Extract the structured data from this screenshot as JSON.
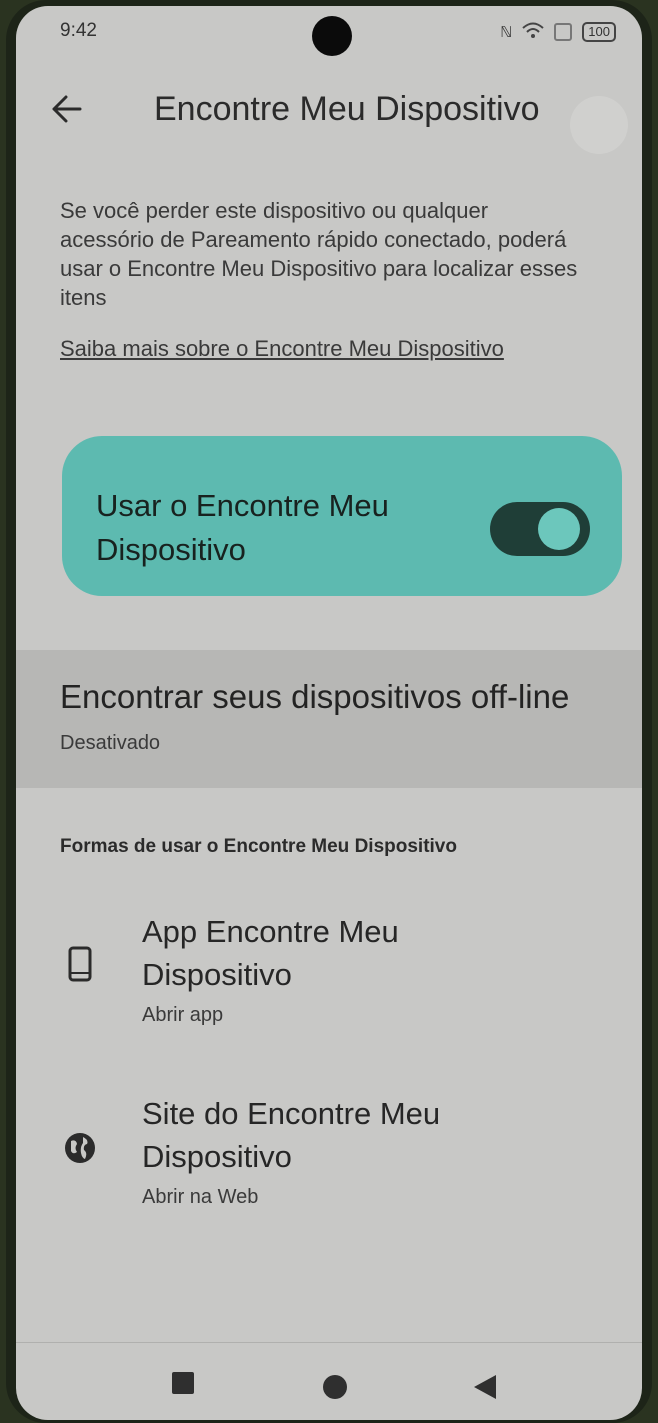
{
  "status_bar": {
    "time": "9:42",
    "battery": "100"
  },
  "app_bar": {
    "title": "Encontre Meu Dispositivo"
  },
  "description": "Se você perder este dispositivo ou qualquer acessório de Pareamento rápido conectado, poderá usar o Encontre Meu Dispositivo para localizar esses itens",
  "learn_more_link": "Saiba mais sobre o Encontre Meu Dispositivo",
  "main_toggle": {
    "label": "Usar o Encontre Meu Dispositivo",
    "state": "on"
  },
  "offline": {
    "title": "Encontrar seus dispositivos off-line",
    "subtitle": "Desativado"
  },
  "ways_section": {
    "header": "Formas de usar o Encontre Meu Dispositivo",
    "items": [
      {
        "title": "App Encontre Meu Dispositivo",
        "subtitle": "Abrir app",
        "icon": "phone-icon"
      },
      {
        "title": "Site do Encontre Meu Dispositivo",
        "subtitle": "Abrir na Web",
        "icon": "globe-icon"
      }
    ]
  },
  "colors": {
    "toggle_card": "#5dbab0",
    "switch_track": "#1f3e37",
    "screen_bg": "#c8c8c6"
  }
}
